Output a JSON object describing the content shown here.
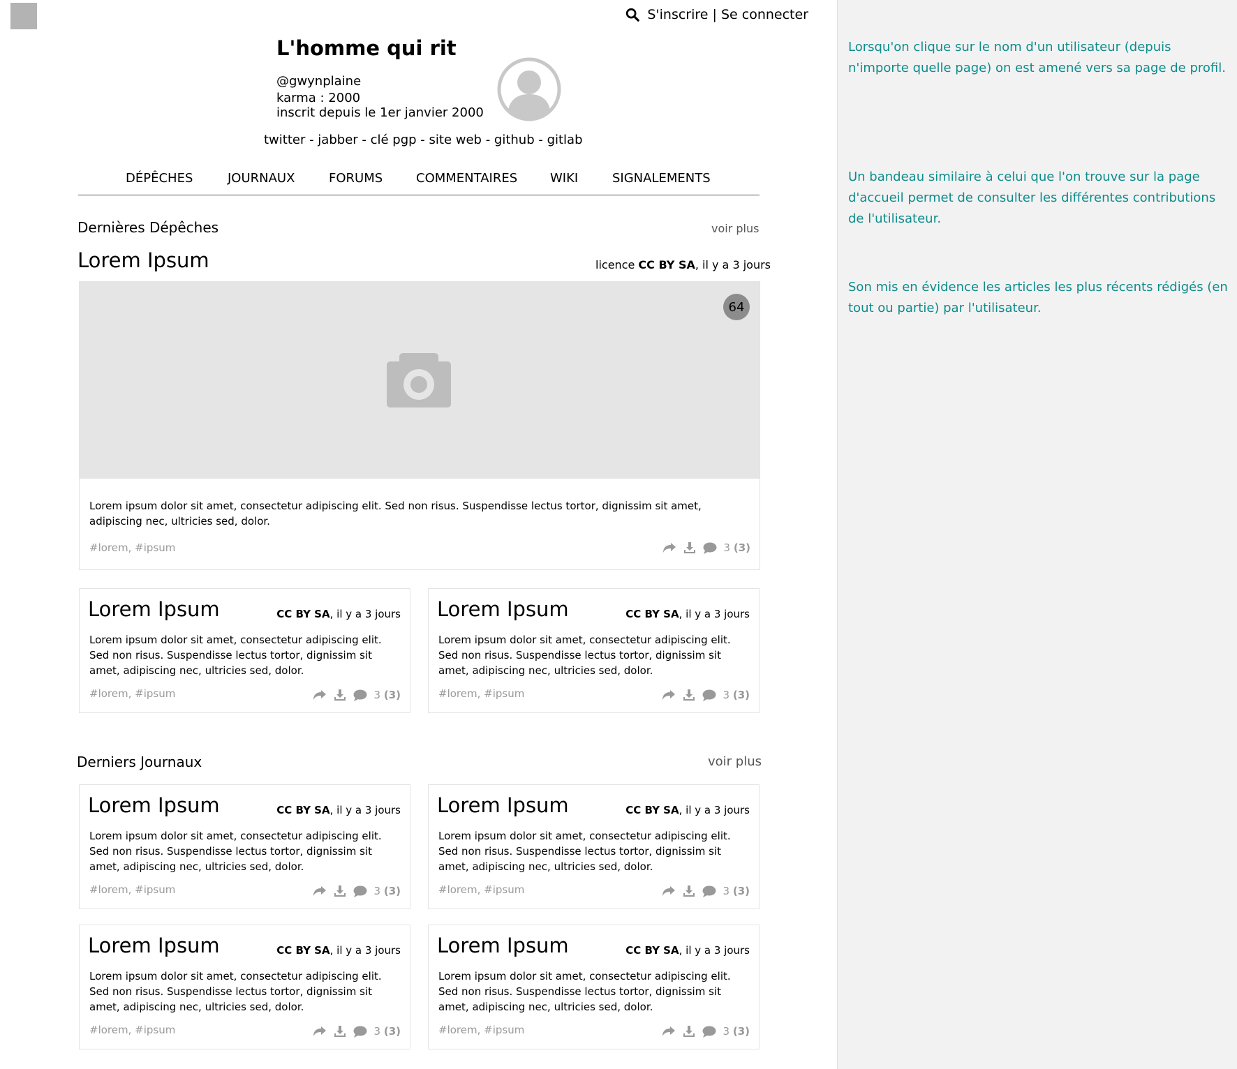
{
  "header": {
    "signup_login": "S'inscrire | Se connecter"
  },
  "profile": {
    "name": "L'homme qui rit",
    "handle": "@gwynplaine",
    "karma": "karma : 2000",
    "since": "inscrit depuis le 1er janvier 2000",
    "links": "twitter - jabber - clé pgp - site web - github - gitlab"
  },
  "nav": {
    "items": [
      "DÉPÊCHES",
      "JOURNAUX",
      "FORUMS",
      "COMMENTAIRES",
      "WIKI",
      "SIGNALEMENTS"
    ]
  },
  "depeches": {
    "section_title": "Dernières Dépêches",
    "voir_plus": "voir plus",
    "hero": {
      "title": "Lorem Ipsum",
      "license_prefix": "licence ",
      "license": "CC BY SA",
      "age": ", il y a 3 jours",
      "badge": "64",
      "excerpt": "Lorem ipsum dolor sit amet, consectetur adipiscing elit. Sed non risus. Suspendisse lectus  tortor, dignissim sit amet, adipiscing nec, ultricies sed, dolor.",
      "tags": "#lorem, #ipsum",
      "comments": "3",
      "comments_new": "(3)"
    },
    "cards": [
      {
        "title": "Lorem Ipsum",
        "license": "CC BY SA",
        "age": ", il y a 3 jours",
        "excerpt": "Lorem ipsum dolor sit amet, consectetur adipiscing elit. Sed non risus. Suspendisse lectus  tortor, dignissim sit amet, adipiscing nec, ultricies sed, dolor.",
        "tags": "#lorem, #ipsum",
        "comments": "3",
        "comments_new": "(3)"
      },
      {
        "title": "Lorem Ipsum",
        "license": "CC BY SA",
        "age": ", il y a 3 jours",
        "excerpt": "Lorem ipsum dolor sit amet, consectetur adipiscing elit. Sed non risus. Suspendisse lectus  tortor, dignissim sit amet, adipiscing nec, ultricies sed, dolor.",
        "tags": "#lorem, #ipsum",
        "comments": "3",
        "comments_new": "(3)"
      }
    ]
  },
  "journaux": {
    "section_title": "Derniers Journaux",
    "voir_plus": "voir plus",
    "cards": [
      {
        "title": "Lorem Ipsum",
        "license": "CC BY SA",
        "age": ", il y a 3 jours",
        "excerpt": "Lorem ipsum dolor sit amet, consectetur adipiscing elit. Sed non risus. Suspendisse lectus  tortor, dignissim sit amet, adipiscing nec, ultricies sed, dolor.",
        "tags": "#lorem, #ipsum",
        "comments": "3",
        "comments_new": "(3)"
      },
      {
        "title": "Lorem Ipsum",
        "license": "CC BY SA",
        "age": ", il y a 3 jours",
        "excerpt": "Lorem ipsum dolor sit amet, consectetur adipiscing elit. Sed non risus. Suspendisse lectus  tortor, dignissim sit amet, adipiscing nec, ultricies sed, dolor.",
        "tags": "#lorem, #ipsum",
        "comments": "3",
        "comments_new": "(3)"
      },
      {
        "title": "Lorem Ipsum",
        "license": "CC BY SA",
        "age": ", il y a 3 jours",
        "excerpt": "Lorem ipsum dolor sit amet, consectetur adipiscing elit. Sed non risus. Suspendisse lectus  tortor, dignissim sit amet, adipiscing nec, ultricies sed, dolor.",
        "tags": "#lorem, #ipsum",
        "comments": "3",
        "comments_new": "(3)"
      },
      {
        "title": "Lorem Ipsum",
        "license": "CC BY SA",
        "age": ", il y a 3 jours",
        "excerpt": "Lorem ipsum dolor sit amet, consectetur adipiscing elit. Sed non risus. Suspendisse lectus  tortor, dignissim sit amet, adipiscing nec, ultricies sed, dolor.",
        "tags": "#lorem, #ipsum",
        "comments": "3",
        "comments_new": "(3)"
      }
    ]
  },
  "notes": [
    "Lorsqu'on clique sur le nom d'un utilisateur (depuis n'importe quelle page) on est amené vers sa page de profil.",
    "Un bandeau similaire à celui que l'on trouve sur la page d'accueil permet de consulter les différentes contributions de l'utilisateur.",
    "Son mis en évidence les articles les plus récents rédigés (en tout ou partie) par l'utilisateur."
  ],
  "colors": {
    "note_text": "#0e8c8c",
    "panel_bg": "#f2f2f2",
    "placeholder_gray": "#e5e5e5",
    "icon_gray": "#999999"
  }
}
